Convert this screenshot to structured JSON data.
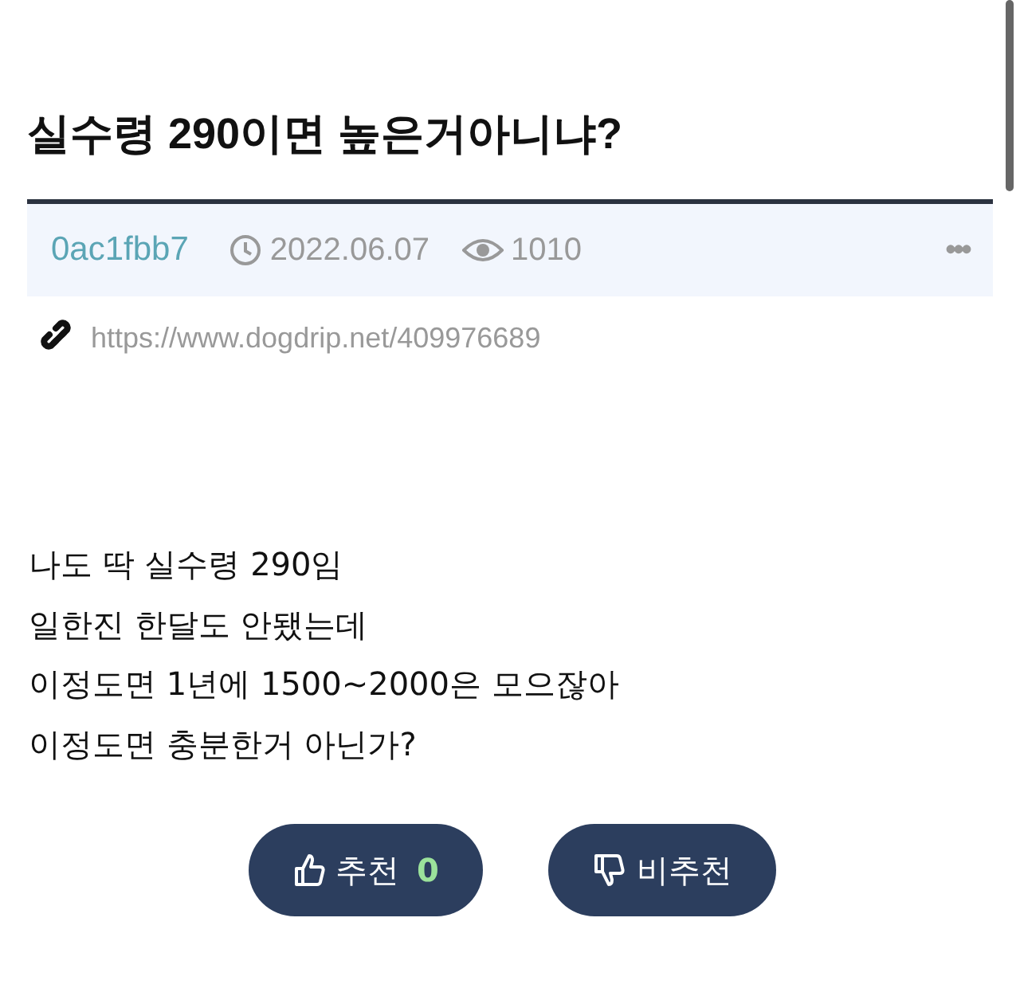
{
  "post": {
    "title": "실수령 290이면 높은거아니냐?",
    "author": "0ac1fbb7",
    "date": "2022.06.07",
    "views": "1010",
    "more": "•••",
    "source_url": "https://www.dogdrip.net/409976689",
    "body_lines": [
      "나도 딱 실수령 290임",
      "일한진 한달도 안됐는데",
      "이정도면 1년에 1500~2000은 모으잖아",
      "이정도면 충분한거 아닌가?"
    ],
    "votes": [
      {
        "kind": "up",
        "label": "추천",
        "count": "0"
      },
      {
        "kind": "down",
        "label": "비추천"
      }
    ]
  }
}
